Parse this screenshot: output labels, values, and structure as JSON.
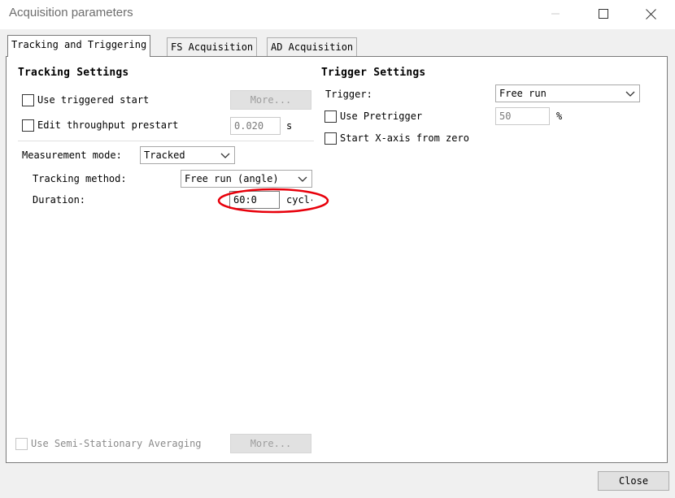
{
  "window": {
    "title": "Acquisition parameters",
    "minimize_icon": "minimize-icon",
    "maximize_icon": "maximize-icon",
    "close_icon": "close-icon"
  },
  "tabs": [
    {
      "label": "Tracking  and Triggering",
      "active": true
    },
    {
      "label": "FS Acquisition",
      "active": false
    },
    {
      "label": "AD Acquisition",
      "active": false
    }
  ],
  "tracking": {
    "heading": "Tracking Settings",
    "use_triggered_start": {
      "label": "Use triggered start",
      "checked": false
    },
    "more_button": "More...",
    "edit_throughput_prestart": {
      "label": "Edit throughput prestart",
      "checked": false
    },
    "prestart_value": "0.020",
    "prestart_unit": "s",
    "measurement_mode_label": "Measurement mode:",
    "measurement_mode_value": "Tracked",
    "tracking_method_label": "Tracking method:",
    "tracking_method_value": "Free run (angle)",
    "duration_label": "Duration:",
    "duration_value": "60:0",
    "duration_unit": "cycl‹",
    "semi_stationary": {
      "label": "Use Semi-Stationary Averaging",
      "checked": false
    },
    "semi_more_button": "More..."
  },
  "trigger": {
    "heading": "Trigger Settings",
    "trigger_label": "Trigger:",
    "trigger_value": "Free run",
    "use_pretrigger": {
      "label": "Use Pretrigger",
      "checked": false
    },
    "pretrigger_value": "50",
    "pretrigger_unit": "%",
    "start_x_axis": {
      "label": "Start X-axis from zero",
      "checked": false
    }
  },
  "footer": {
    "close_button": "Close"
  },
  "annotation": {
    "color": "#e8000b",
    "target": "duration-field"
  }
}
